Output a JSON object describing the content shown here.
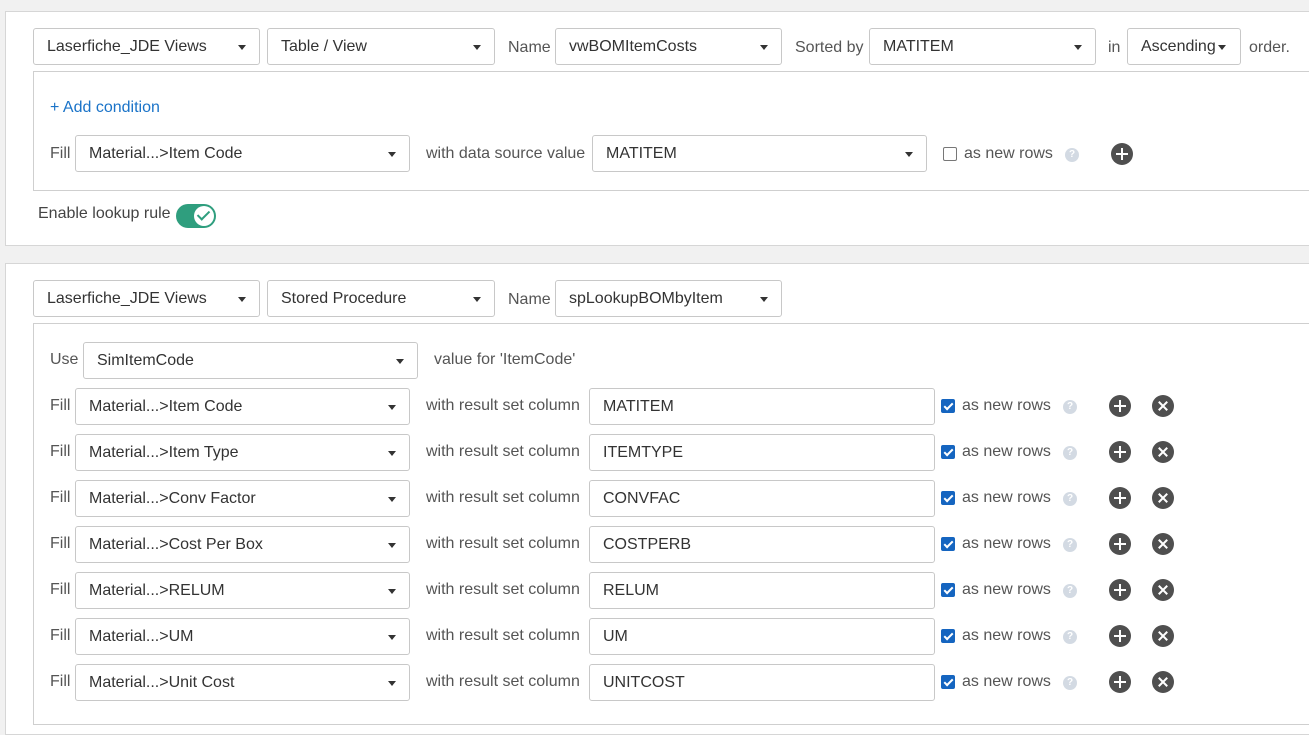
{
  "rule1": {
    "source": "Laserfiche_JDE Views",
    "type": "Table / View",
    "name_label": "Name",
    "name": "vwBOMItemCosts",
    "sorted_label": "Sorted by",
    "sorted": "MATITEM",
    "in_label": "in",
    "order": "Ascending",
    "order_suffix": "order.",
    "add_condition": "+ Add condition",
    "fill_label": "Fill",
    "fill_field": "Material...>Item Code",
    "with_label": "with data source value",
    "with_value": "MATITEM",
    "as_new_rows_label": "as new rows",
    "as_new_rows_checked": false,
    "enable_label": "Enable lookup rule",
    "enabled": true
  },
  "rule2": {
    "source": "Laserfiche_JDE Views",
    "type": "Stored Procedure",
    "name_label": "Name",
    "name": "spLookupBOMbyItem",
    "use_label": "Use",
    "use_value": "SimItemCode",
    "use_suffix": "value for 'ItemCode'",
    "fills": [
      {
        "label": "Fill",
        "field": "Material...>Item Code",
        "with_label": "with result set column",
        "column": "MATITEM",
        "as_new_rows": "as new rows",
        "checked": true
      },
      {
        "label": "Fill",
        "field": "Material...>Item Type",
        "with_label": "with result set column",
        "column": "ITEMTYPE",
        "as_new_rows": "as new rows",
        "checked": true
      },
      {
        "label": "Fill",
        "field": "Material...>Conv Factor",
        "with_label": "with result set column",
        "column": "CONVFAC",
        "as_new_rows": "as new rows",
        "checked": true
      },
      {
        "label": "Fill",
        "field": "Material...>Cost Per Box",
        "with_label": "with result set column",
        "column": "COSTPERB",
        "as_new_rows": "as new rows",
        "checked": true
      },
      {
        "label": "Fill",
        "field": "Material...>RELUM",
        "with_label": "with result set column",
        "column": "RELUM",
        "as_new_rows": "as new rows",
        "checked": true
      },
      {
        "label": "Fill",
        "field": "Material...>UM",
        "with_label": "with result set column",
        "column": "UM",
        "as_new_rows": "as new rows",
        "checked": true
      },
      {
        "label": "Fill",
        "field": "Material...>Unit Cost",
        "with_label": "with result set column",
        "column": "UNITCOST",
        "as_new_rows": "as new rows",
        "checked": true
      }
    ]
  },
  "colors": {
    "accent_link": "#1a73c8",
    "toggle_on": "#2f9e7e",
    "checkbox_checked": "#1565c0"
  }
}
